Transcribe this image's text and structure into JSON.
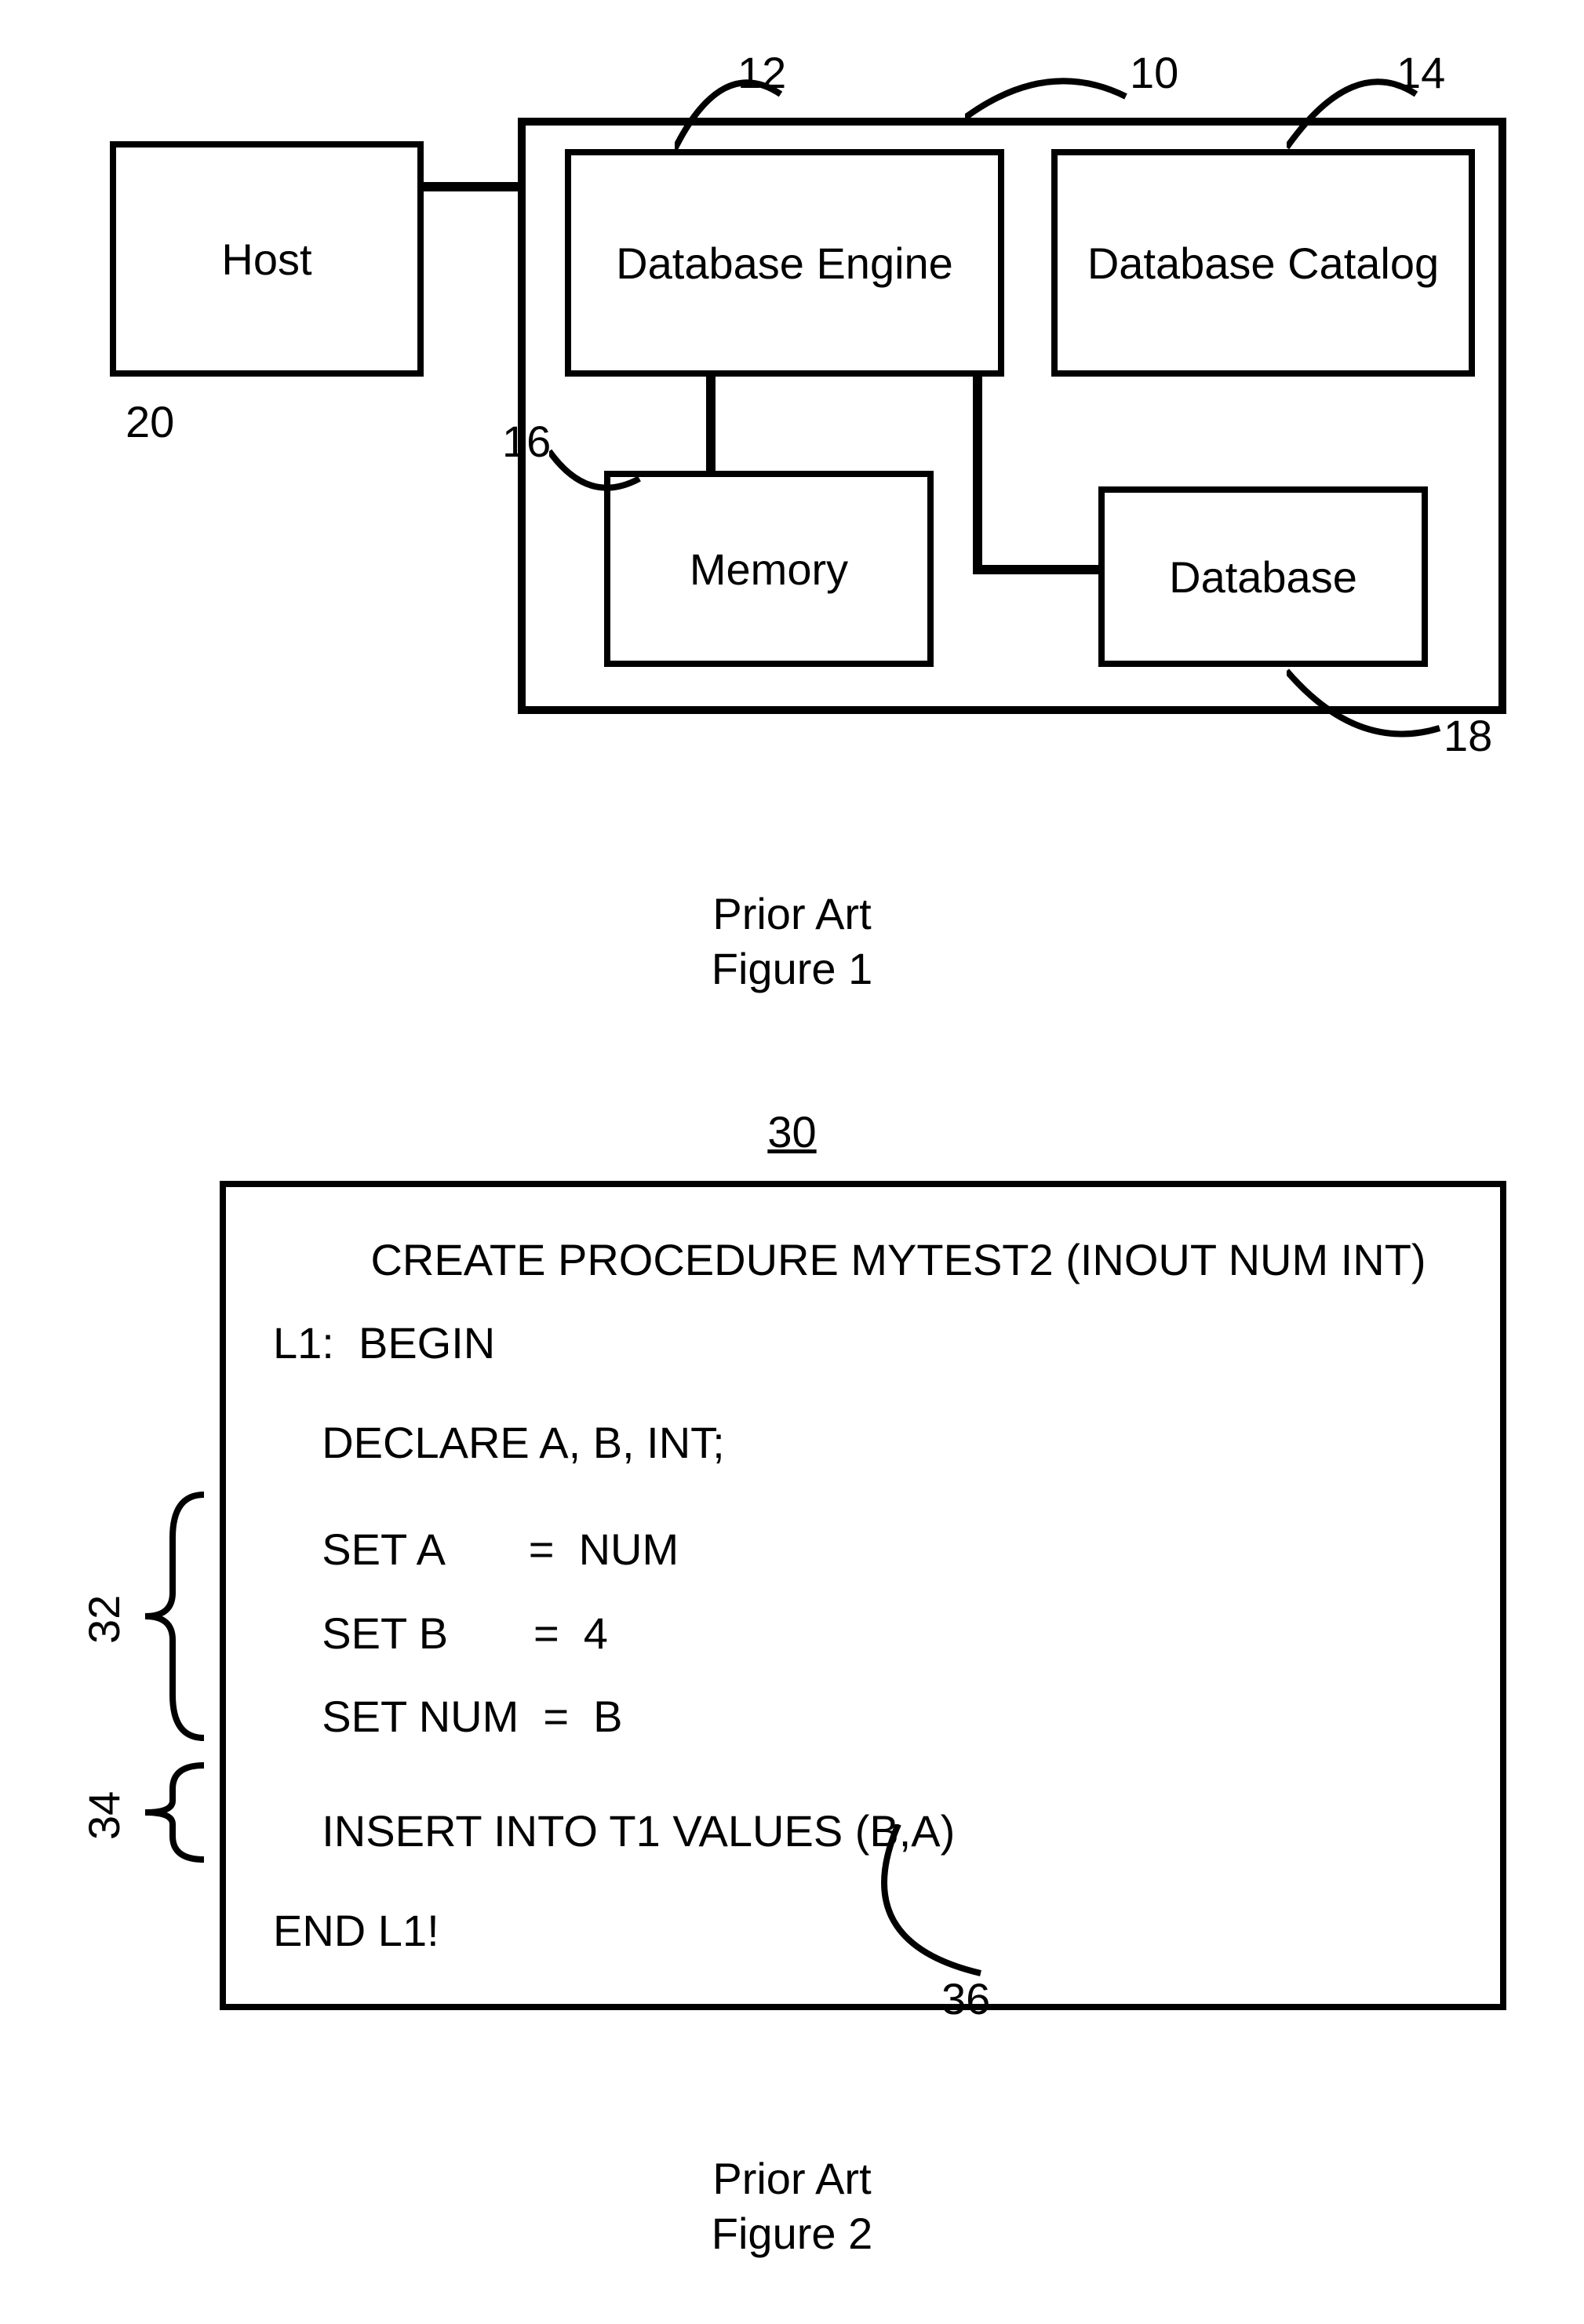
{
  "fig1": {
    "host": "Host",
    "dbengine": "Database Engine",
    "dbcatalog": "Database Catalog",
    "memory": "Memory",
    "database": "Database",
    "n_container": "10",
    "n_engine": "12",
    "n_catalog": "14",
    "n_memory": "16",
    "n_db": "18",
    "n_host": "20",
    "caption1": "Prior Art",
    "caption2": "Figure 1"
  },
  "fig2": {
    "title": "30",
    "lines": {
      "l0": "        CREATE PROCEDURE MYTEST2 (INOUT NUM INT)",
      "l1": "L1:  BEGIN",
      "l2": "    DECLARE A, B, INT;",
      "l3": "    SET A       =  NUM",
      "l4": "    SET B       =  4",
      "l5": "    SET NUM  =  B",
      "l6": "    INSERT INTO T1 VALUES (B,A)",
      "l7": "END L1!"
    },
    "n32": "32",
    "n34": "34",
    "n36": "36",
    "caption1": "Prior Art",
    "caption2": "Figure 2"
  }
}
